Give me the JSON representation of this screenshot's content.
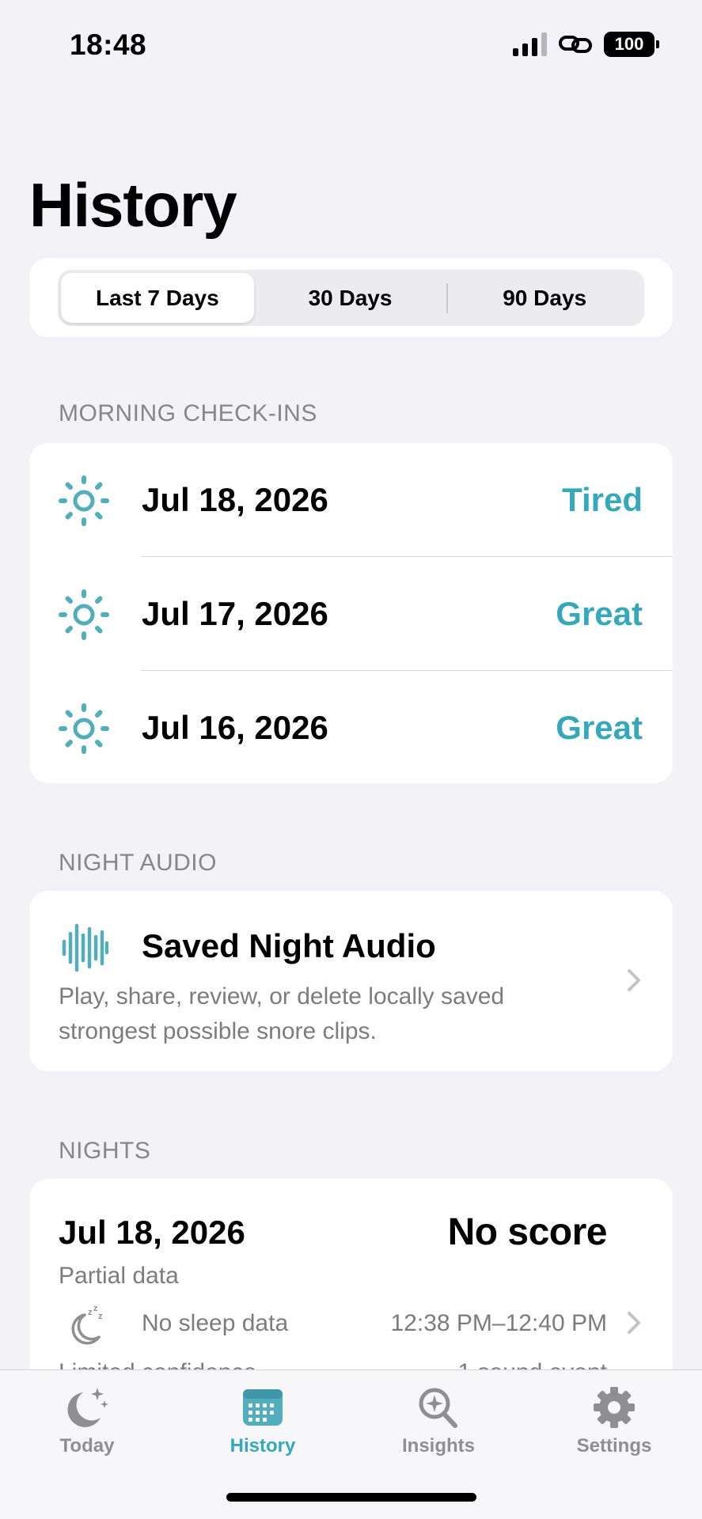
{
  "status_bar": {
    "time": "18:48",
    "battery": "100"
  },
  "page": {
    "title": "History"
  },
  "range_selector": {
    "options": [
      "Last 7 Days",
      "30 Days",
      "90 Days"
    ],
    "selected": "Last 7 Days"
  },
  "morning_checkins": {
    "header": "MORNING CHECK-INS",
    "items": [
      {
        "date": "Jul 18, 2026",
        "mood": "Tired"
      },
      {
        "date": "Jul 17, 2026",
        "mood": "Great"
      },
      {
        "date": "Jul 16, 2026",
        "mood": "Great"
      }
    ]
  },
  "night_audio": {
    "header": "NIGHT AUDIO",
    "title": "Saved Night Audio",
    "description": "Play, share, review, or delete locally saved strongest possible snore clips."
  },
  "nights": {
    "header": "NIGHTS",
    "items": [
      {
        "date": "Jul 18, 2026",
        "score": "No score",
        "status": "Partial data",
        "sleep": "No sleep data",
        "time_range": "12:38 PM–12:40 PM",
        "confidence": "Limited confidence",
        "events": "1 sound event"
      }
    ]
  },
  "tab_bar": {
    "tabs": [
      {
        "label": "Today",
        "icon": "moon-stars-icon"
      },
      {
        "label": "History",
        "icon": "calendar-icon"
      },
      {
        "label": "Insights",
        "icon": "magnifier-sparkle-icon"
      },
      {
        "label": "Settings",
        "icon": "gear-icon"
      }
    ],
    "active": "History"
  },
  "colors": {
    "accent": "#35a8bb",
    "background": "#f2f2f7",
    "secondary_text": "#7c7c80"
  }
}
